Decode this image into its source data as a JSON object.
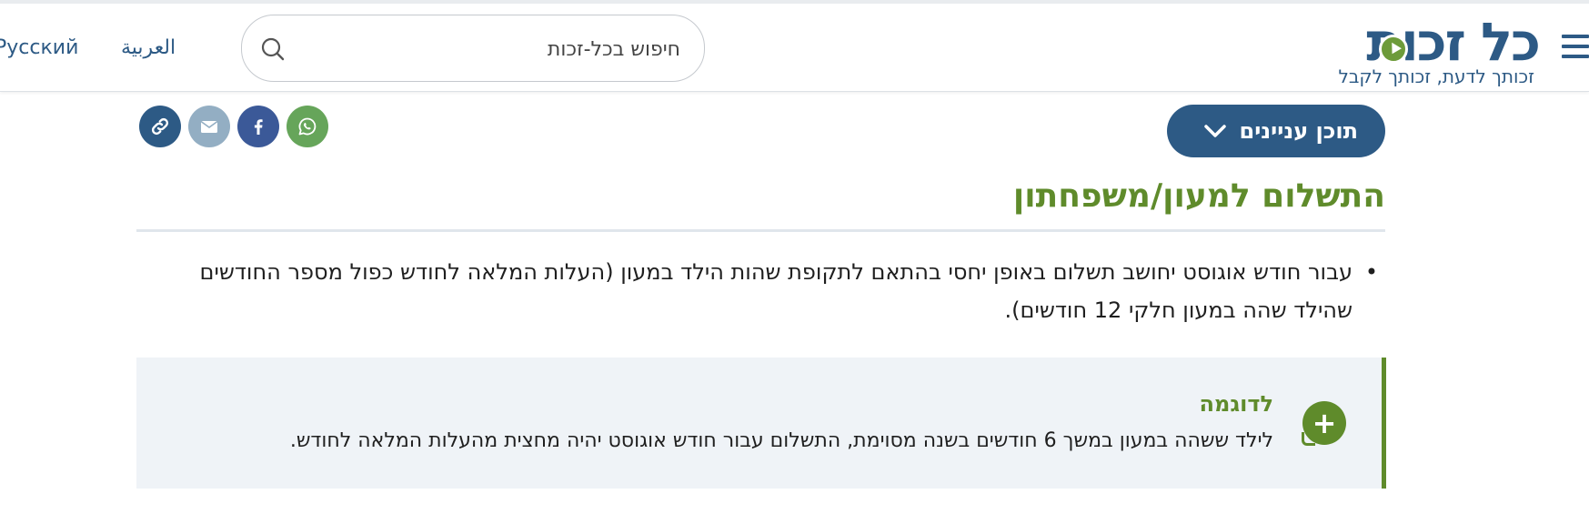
{
  "header": {
    "logo_text": "כל זכות",
    "logo_tagline": "זכותך לדעת, זכותך לקבל",
    "search_placeholder": "חיפוש בכל-זכות",
    "languages": [
      "العربية",
      "Русский"
    ]
  },
  "toolbar": {
    "toc_label": "תוכן עניינים",
    "share_icons": [
      "link-icon",
      "email-icon",
      "facebook-icon",
      "whatsapp-icon"
    ]
  },
  "section": {
    "title": "התשלום למעון/משפחתון",
    "bullet": "•",
    "paragraph": "עבור חודש אוגוסט יחושב תשלום באופן יחסי בהתאם לתקופת שהות הילד במעון (העלות המלאה לחודש כפול מספר החודשים שהילד שהה במעון חלקי 12 חודשים)."
  },
  "example": {
    "title": "לדוגמה",
    "text": "לילד ששהה במעון במשך 6 חודשים בשנה מסוימת, התשלום עבור חודש אוגוסט יהיה מחצית מהעלות המלאה לחודש.",
    "toggle_symbol": "+"
  },
  "colors": {
    "brand_blue": "#2d5a85",
    "accent_green": "#5f8b2b",
    "box_bg": "#eff3f7"
  }
}
